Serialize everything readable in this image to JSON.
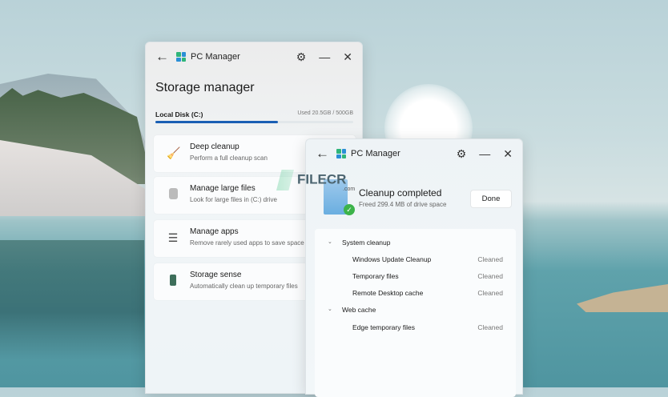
{
  "watermark": {
    "text": "FILECR",
    "suffix": ".com"
  },
  "storage_window": {
    "app_title": "PC Manager",
    "page_title": "Storage manager",
    "disk": {
      "label": "Local Disk (C:)",
      "usage_text": "Used 20.5GB / 500GB",
      "bar_fill_fraction": 0.62
    },
    "items": [
      {
        "title": "Deep cleanup",
        "subtitle": "Perform a full cleanup scan",
        "icon": "broom-icon"
      },
      {
        "title": "Manage large files",
        "subtitle": "Look for large files in (C:) drive",
        "icon": "file-stack-icon"
      },
      {
        "title": "Manage apps",
        "subtitle": "Remove rarely used apps to save space",
        "icon": "list-icon"
      },
      {
        "title": "Storage sense",
        "subtitle": "Automatically clean up temporary files",
        "icon": "storage-icon"
      }
    ]
  },
  "cleanup_window": {
    "app_title": "PC Manager",
    "title": "Cleanup completed",
    "subtitle": "Freed 299.4 MB of drive space",
    "done_label": "Done",
    "groups": [
      {
        "name": "System cleanup",
        "items": [
          {
            "name": "Windows Update Cleanup",
            "status": "Cleaned"
          },
          {
            "name": "Temporary files",
            "status": "Cleaned"
          },
          {
            "name": "Remote Desktop cache",
            "status": "Cleaned"
          }
        ]
      },
      {
        "name": "Web cache",
        "items": [
          {
            "name": "Edge temporary files",
            "status": "Cleaned"
          }
        ]
      }
    ]
  },
  "colors": {
    "accent": "#1a5fb4",
    "success": "#3cb34a"
  }
}
